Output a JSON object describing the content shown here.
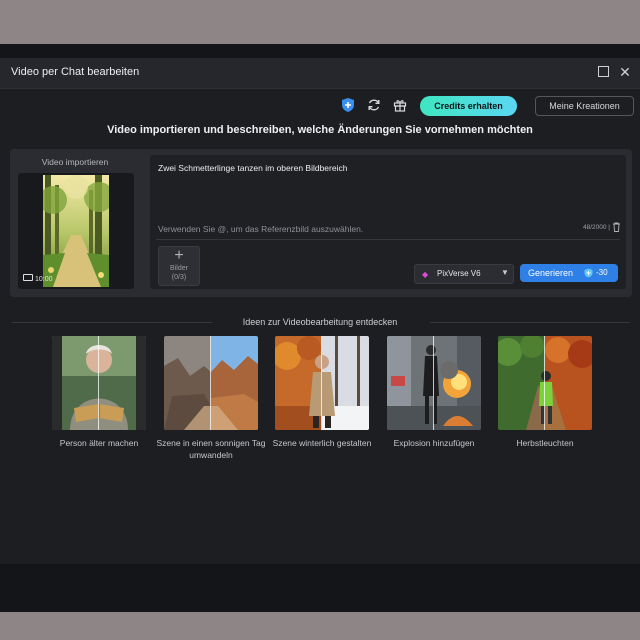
{
  "window": {
    "title": "Video per Chat bearbeiten"
  },
  "toolbar": {
    "credits_label": "Credits erhalten",
    "kreationen_label": "Meine Kreationen"
  },
  "heading": "Video importieren und beschreiben, welche Änderungen Sie vornehmen möchten",
  "import": {
    "label": "Video importieren",
    "duration": "10:00"
  },
  "prompt": {
    "text": "Zwei Schmetterlinge tanzen im oberen Bildbereich",
    "hint": "Verwenden Sie @, um das Referenzbild auszuwählen.",
    "counter": "48/2000 |"
  },
  "bilder": {
    "label": "Bilder",
    "count": "(0/3)"
  },
  "model": {
    "name": "PixVerse V6"
  },
  "generate": {
    "label": "Generieren",
    "cost": "-30"
  },
  "ideas": {
    "title": "Ideen zur Videobearbeitung entdecken",
    "items": [
      {
        "label": "Person älter machen"
      },
      {
        "label": "Szene in einen sonnigen Tag umwandeln"
      },
      {
        "label": "Szene winterlich gestalten"
      },
      {
        "label": "Explosion hinzufügen"
      },
      {
        "label": "Herbstleuchten"
      }
    ]
  },
  "colors": {
    "accent": "#2e7fe6",
    "credits_from": "#3fe6c1",
    "credits_to": "#5bd6f2"
  }
}
